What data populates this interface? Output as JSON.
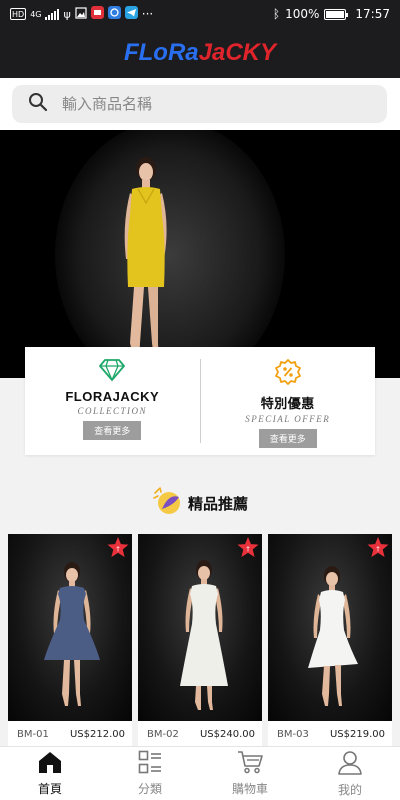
{
  "status_bar": {
    "hd": "HD",
    "network": "4G",
    "battery_text": "100%",
    "battery_level": 1.0,
    "time": "17:57",
    "more": "···"
  },
  "header": {
    "logo_part1": "FLoRa",
    "logo_part2": "JaCKY",
    "logo_colors": {
      "part1": "#2a6ff0",
      "part2": "#e0242b"
    }
  },
  "search": {
    "placeholder": "輸入商品名稱",
    "value": ""
  },
  "cards": [
    {
      "icon": "diamond-icon",
      "title": "FLORAJACKY",
      "subtitle": "COLLECTION",
      "button": "查看更多",
      "icon_color": "#1fa86a"
    },
    {
      "icon": "percent-icon",
      "title": "特別優惠",
      "subtitle": "SPECIAL OFFER",
      "button": "查看更多",
      "icon_color": "#f0a010"
    }
  ],
  "recommend": {
    "title": "精品推薦"
  },
  "products": [
    {
      "code": "BM-01",
      "price": "US$212.00",
      "dress_color": "#4c5d85"
    },
    {
      "code": "BM-02",
      "price": "US$240.00",
      "dress_color": "#efefea"
    },
    {
      "code": "BM-03",
      "price": "US$219.00",
      "dress_color": "#f4f4f2"
    }
  ],
  "nav": [
    {
      "label": "首頁",
      "icon": "home-icon",
      "active": true
    },
    {
      "label": "分類",
      "icon": "category-icon",
      "active": false
    },
    {
      "label": "購物車",
      "icon": "cart-icon",
      "active": false
    },
    {
      "label": "我的",
      "icon": "user-icon",
      "active": false
    }
  ],
  "colors": {
    "dark_bar": "#1c1c1e",
    "accent_red": "#e8313a",
    "button_gray": "#9d9d9d",
    "banner_dress": "#e3c41f"
  }
}
